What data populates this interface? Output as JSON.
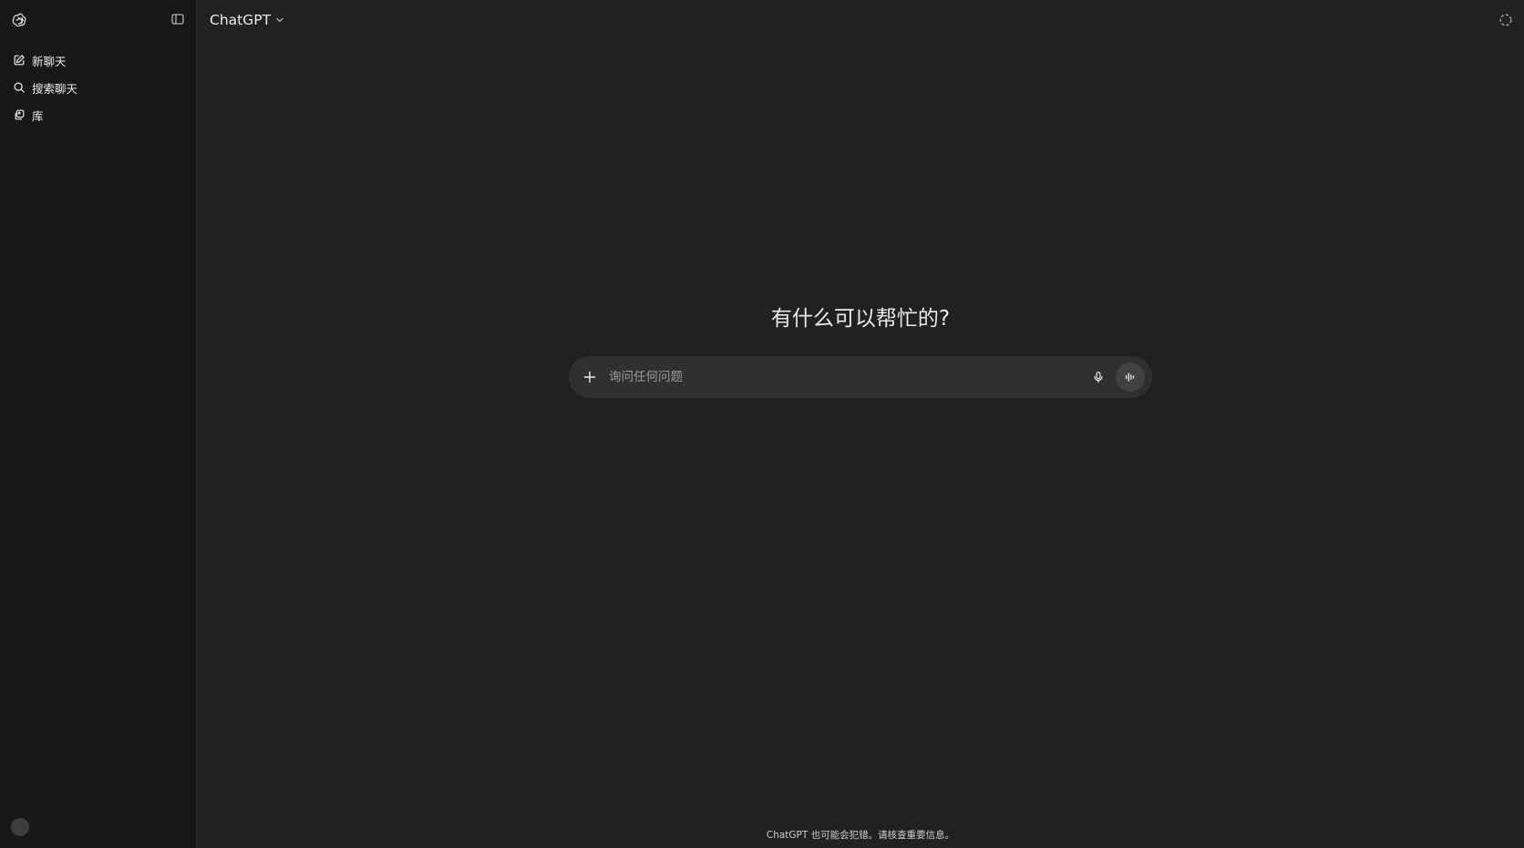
{
  "sidebar": {
    "items": [
      {
        "label": "新聊天",
        "icon": "edit-icon"
      },
      {
        "label": "搜索聊天",
        "icon": "search-icon"
      },
      {
        "label": "库",
        "icon": "library-icon"
      }
    ]
  },
  "header": {
    "model_name": "ChatGPT"
  },
  "main": {
    "headline": "有什么可以帮忙的?",
    "composer": {
      "placeholder": "询问任何问题"
    },
    "footer_note": "ChatGPT 也可能会犯错。请核查重要信息。"
  },
  "colors": {
    "sidebar_bg": "#171717",
    "main_bg": "#212121",
    "composer_bg": "#303030",
    "text": "#ececec"
  }
}
